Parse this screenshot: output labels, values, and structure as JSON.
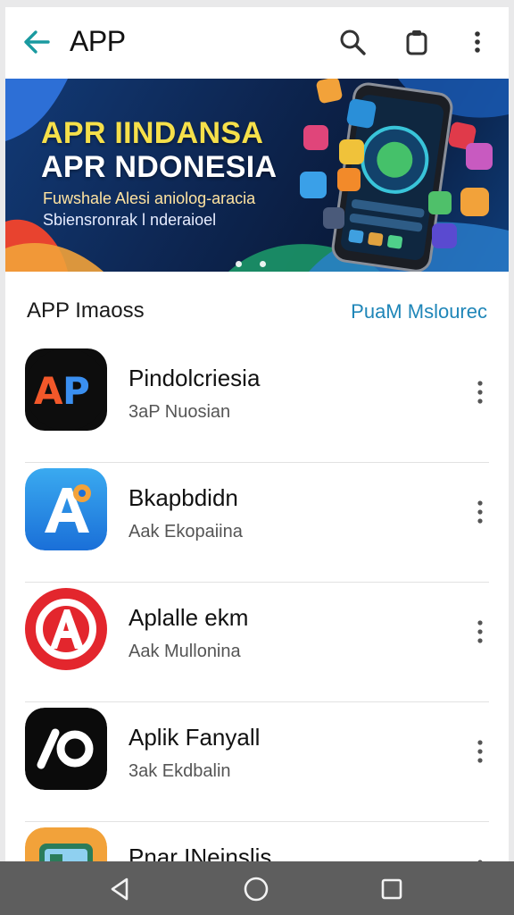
{
  "header": {
    "title": "APP",
    "back_icon": "arrow-left-icon",
    "actions": [
      "search-icon",
      "clipboard-icon",
      "more-vert-icon"
    ],
    "accent_color": "#1a9aa0"
  },
  "banner": {
    "title_line1": "APR IINDANSA",
    "title_line2": "APR NDONESIA",
    "subtitle_line1": "Fuwshale Alesi aniolog-aracia",
    "subtitle_line2": "Sbiensronrak l nderaioel",
    "page_indicator_count": 2
  },
  "section": {
    "title": "APP Imaoss",
    "link": "PuaM Mslourec",
    "link_color": "#1f86b8"
  },
  "apps": [
    {
      "name": "Pindolcriesia",
      "subtitle": "3aP Nuosian",
      "icon": "ap-logo-icon"
    },
    {
      "name": "Bkapbdidn",
      "subtitle": "Aak Ekopaiina",
      "icon": "a-star-logo-icon"
    },
    {
      "name": "Aplalle ekm",
      "subtitle": "Aak Mullonina",
      "icon": "a-circle-logo-icon"
    },
    {
      "name": "Aplik Fanyall",
      "subtitle": "3ak Ekdbalin",
      "icon": "io-logo-icon"
    },
    {
      "name": "Pnar INeinslis",
      "subtitle": "",
      "icon": "tablet-logo-icon"
    }
  ],
  "nav": [
    "back-triangle-icon",
    "home-circle-icon",
    "recents-square-icon"
  ]
}
